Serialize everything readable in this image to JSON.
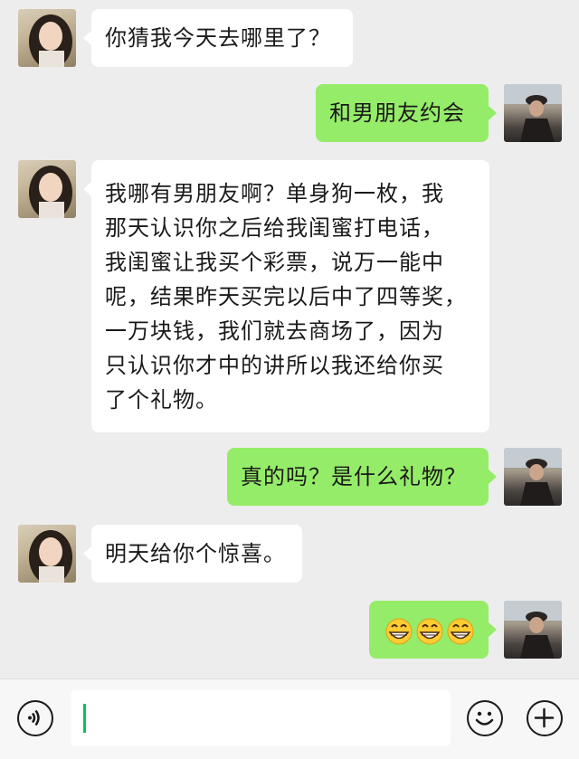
{
  "messages": [
    {
      "sender": "her",
      "lines": [
        "你猜我今天去哪里了？"
      ]
    },
    {
      "sender": "me",
      "lines": [
        "和男朋友约会"
      ]
    },
    {
      "sender": "her",
      "lines": [
        "我哪有男朋友啊？单身狗一枚，我",
        "那天认识你之后给我闺蜜打电话，",
        "我闺蜜让我买个彩票，说万一能中",
        "呢，结果昨天买完以后中了四等奖，",
        "一万块钱，我们就去商场了，因为",
        "只认识你才中的讲所以我还给你买",
        "了个礼物。"
      ]
    },
    {
      "sender": "me",
      "lines": [
        "真的吗？是什么礼物？"
      ]
    },
    {
      "sender": "her",
      "lines": [
        "明天给你个惊喜。"
      ]
    },
    {
      "sender": "me",
      "emoji": [
        "grin-emoji",
        "grin-emoji",
        "grin-emoji"
      ],
      "text": "😁😁😁"
    }
  ],
  "input": {
    "value": ""
  },
  "icons": {
    "voice": "voice-icon",
    "emoji": "emoji-face-icon",
    "plus": "plus-icon"
  },
  "colors": {
    "background": "#ededed",
    "sent_bubble": "#95ec69",
    "received_bubble": "#ffffff",
    "cursor": "#07c160"
  }
}
